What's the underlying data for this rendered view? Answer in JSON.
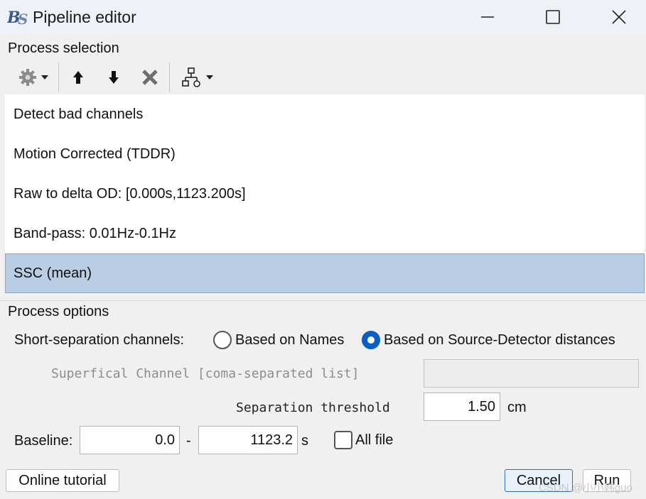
{
  "window": {
    "title": "Pipeline editor",
    "logo_text": "BS",
    "controls": {
      "minimize": "minimize-icon",
      "maximize": "maximize-icon",
      "close": "close-icon"
    }
  },
  "process_selection": {
    "label": "Process selection",
    "toolbar": {
      "icons": [
        "gear-icon",
        "dropdown-arrow-icon",
        "move-up-icon",
        "move-down-icon",
        "delete-icon",
        "pipeline-tree-icon",
        "dropdown-arrow-icon"
      ]
    },
    "items": [
      {
        "label": "Detect bad channels",
        "selected": false
      },
      {
        "label": "Motion Corrected (TDDR)",
        "selected": false
      },
      {
        "label": "Raw to delta OD: [0.000s,1123.200s]",
        "selected": false
      },
      {
        "label": "Band-pass: 0.01Hz-0.1Hz",
        "selected": false
      },
      {
        "label": "SSC (mean)",
        "selected": true
      }
    ],
    "selected_color": "#b9cde5"
  },
  "process_options": {
    "label": "Process options",
    "short_separation": {
      "label": "Short-separation channels:",
      "options": [
        {
          "label": "Based on Names",
          "checked": false
        },
        {
          "label": "Based on Source-Detector distances",
          "checked": true
        }
      ]
    },
    "superficial_channel": {
      "label": "Superfical Channel [coma-separated list]",
      "value": "",
      "enabled": false
    },
    "separation_threshold": {
      "label": "Separation threshold",
      "value": "1.50",
      "unit": "cm"
    },
    "baseline": {
      "label": "Baseline:",
      "start": "0.0",
      "separator": "-",
      "end": "1123.2",
      "unit": "s",
      "all_file_label": "All file",
      "all_file_checked": false
    }
  },
  "buttons": {
    "online_tutorial": "Online tutorial",
    "cancel": "Cancel",
    "run": "Run"
  },
  "watermark": "CSDN @小小韩guo",
  "accent_color": "#0a5fc2"
}
